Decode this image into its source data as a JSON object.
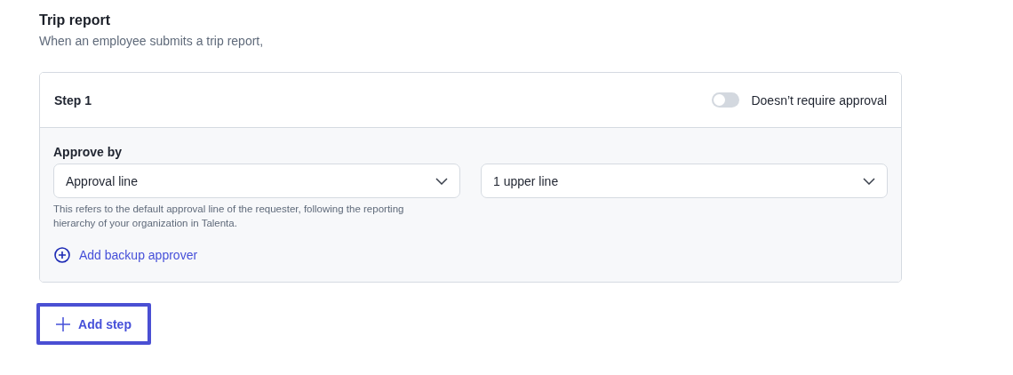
{
  "section": {
    "title": "Trip report",
    "subtitle": "When an employee submits a trip report,"
  },
  "steps": [
    {
      "title": "Step 1",
      "toggle": {
        "label": "Doesn’t require approval",
        "on": false
      },
      "approve_by": {
        "label": "Approve by",
        "selects": [
          {
            "value": "Approval line"
          },
          {
            "value": "1 upper line"
          }
        ],
        "helper": "This refers to the default approval line of the requester, following the reporting hierarchy of your organization in Talenta."
      },
      "backup_link": "Add backup approver"
    }
  ],
  "add_step": {
    "label": "Add step",
    "focused": true
  }
}
